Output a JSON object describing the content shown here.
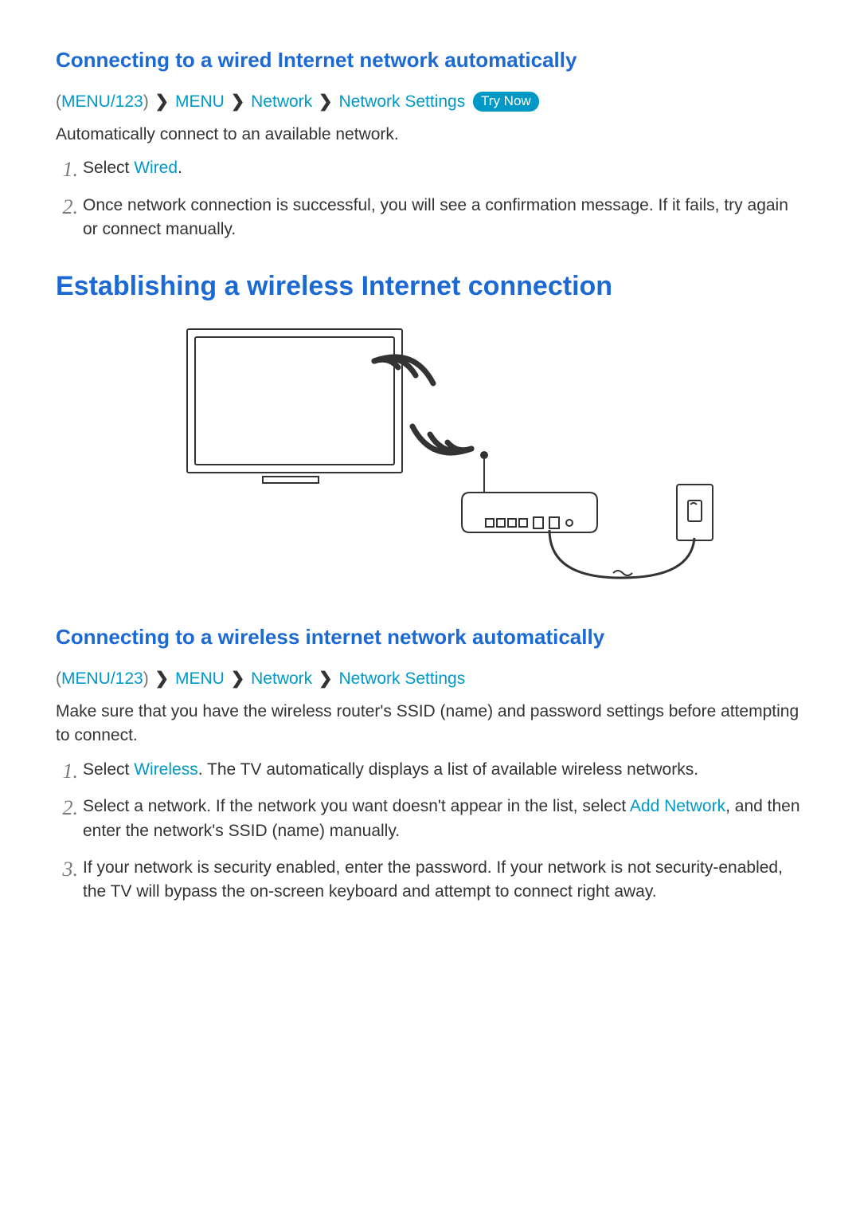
{
  "sec1": {
    "title": "Connecting to a wired Internet network automatically",
    "path_menu123": "MENU/123",
    "path_menu": "MENU",
    "path_network": "Network",
    "path_settings": "Network Settings",
    "try_now": "Try Now",
    "intro": "Automatically connect to an available network.",
    "step1_num": "1.",
    "step1_pre": "Select ",
    "step1_kw": "Wired",
    "step1_post": ".",
    "step2_num": "2.",
    "step2": "Once network connection is successful, you will see a confirmation message. If it fails, try again or connect manually."
  },
  "sec2": {
    "main_title": "Establishing a wireless Internet connection"
  },
  "sec3": {
    "title": "Connecting to a wireless internet network automatically",
    "path_menu123": "MENU/123",
    "path_menu": "MENU",
    "path_network": "Network",
    "path_settings": "Network Settings",
    "intro": "Make sure that you have the wireless router's SSID (name) and password settings before attempting to connect.",
    "step1_num": "1.",
    "step1_pre": "Select ",
    "step1_kw": "Wireless",
    "step1_post": ". The TV automatically displays a list of available wireless networks.",
    "step2_num": "2.",
    "step2_pre": "Select a network. If the network you want doesn't appear in the list, select ",
    "step2_kw": "Add Network",
    "step2_post": ", and then enter the network's SSID (name) manually.",
    "step3_num": "3.",
    "step3": "If your network is security enabled, enter the password. If your network is not security-enabled, the TV will bypass the on-screen keyboard and attempt to connect right away."
  }
}
